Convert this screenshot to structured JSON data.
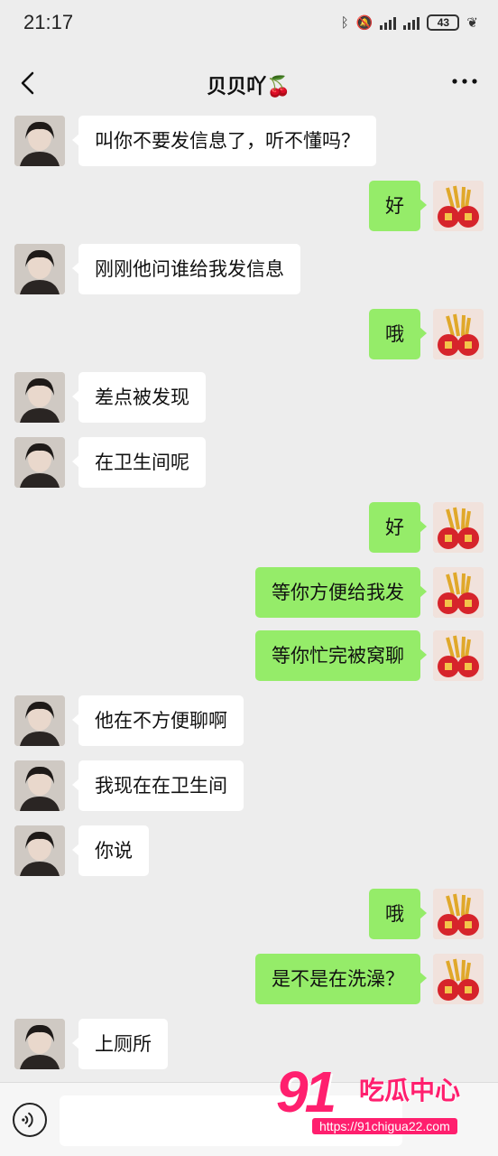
{
  "status_bar": {
    "time": "21:17",
    "battery": "43",
    "icons": [
      "bluetooth-icon",
      "mute-icon",
      "signal-icon",
      "signal-icon",
      "battery-icon",
      "leaf-icon"
    ]
  },
  "header": {
    "title": "贝贝吖🍒",
    "back_icon": "chevron-left-icon",
    "more_icon": "more-dots-icon"
  },
  "messages": [
    {
      "side": "left",
      "text": "叫你不要发信息了，听不懂吗？"
    },
    {
      "side": "right",
      "text": "好"
    },
    {
      "side": "left",
      "text": "刚刚他问谁给我发信息"
    },
    {
      "side": "right",
      "text": "哦"
    },
    {
      "side": "left",
      "text": "差点被发现"
    },
    {
      "side": "left",
      "text": "在卫生间呢"
    },
    {
      "side": "right",
      "text": "好"
    },
    {
      "side": "right",
      "text": "等你方便给我发"
    },
    {
      "side": "right",
      "text": "等你忙完被窝聊"
    },
    {
      "side": "left",
      "text": "他在不方便聊啊"
    },
    {
      "side": "left",
      "text": "我现在在卫生间"
    },
    {
      "side": "left",
      "text": "你说"
    },
    {
      "side": "right",
      "text": "哦"
    },
    {
      "side": "right",
      "text": "是不是在洗澡？"
    },
    {
      "side": "left",
      "text": "上厕所"
    }
  ],
  "input_bar": {
    "voice_icon": "voice-icon",
    "value": ""
  },
  "watermark": {
    "number": "91",
    "name": "吃瓜中心",
    "url": "https://91chigua22.com"
  },
  "colors": {
    "background": "#ededed",
    "bubble_left": "#ffffff",
    "bubble_right": "#95ec69",
    "watermark": "#ff1f6e"
  }
}
